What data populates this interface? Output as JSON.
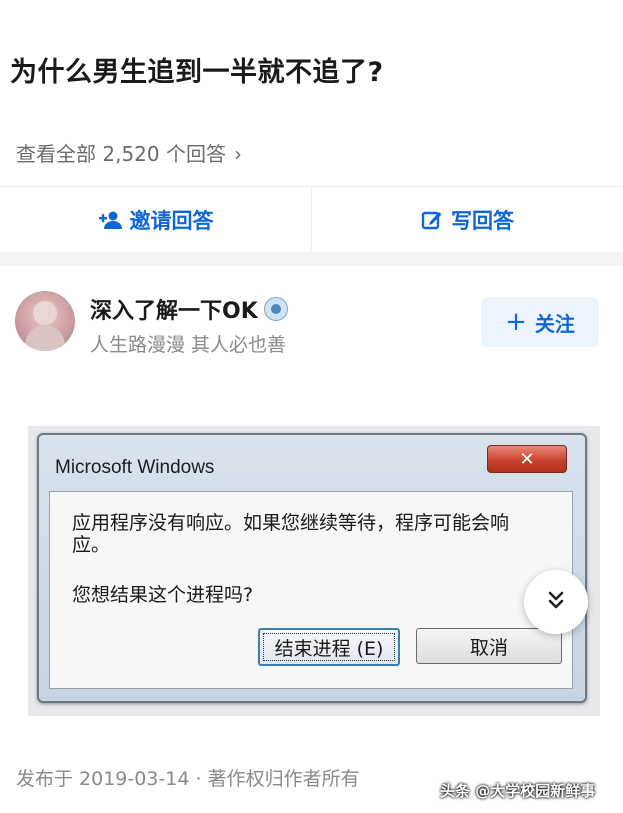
{
  "question": {
    "title": "为什么男生追到一半就不追了?",
    "view_all_label": "查看全部 2,520 个回答",
    "view_all_chevron": "›"
  },
  "actions": {
    "invite_label": "邀请回答",
    "invite_icon": "add-user-icon",
    "write_label": "写回答",
    "write_icon": "edit-icon"
  },
  "author": {
    "name": "深入了解一下OK",
    "bio": "人生路漫漫 其人必也善",
    "follow_label": "关注",
    "follow_plus": "+"
  },
  "dialog": {
    "title": "Microsoft Windows",
    "close_symbol": "✕",
    "message": "应用程序没有响应。如果您继续等待，程序可能会响应。",
    "question": "您想结果这个进程吗?",
    "end_process_label": "结束进程 (E)",
    "cancel_label": "取消"
  },
  "footer": {
    "published": "发布于 2019-03-14 · 著作权归作者所有",
    "watermark": "头条 @大学校园新鲜事"
  },
  "colors": {
    "accent": "#0f66d6",
    "muted_text": "#8a8a8a",
    "close_red": "#c7432f"
  }
}
